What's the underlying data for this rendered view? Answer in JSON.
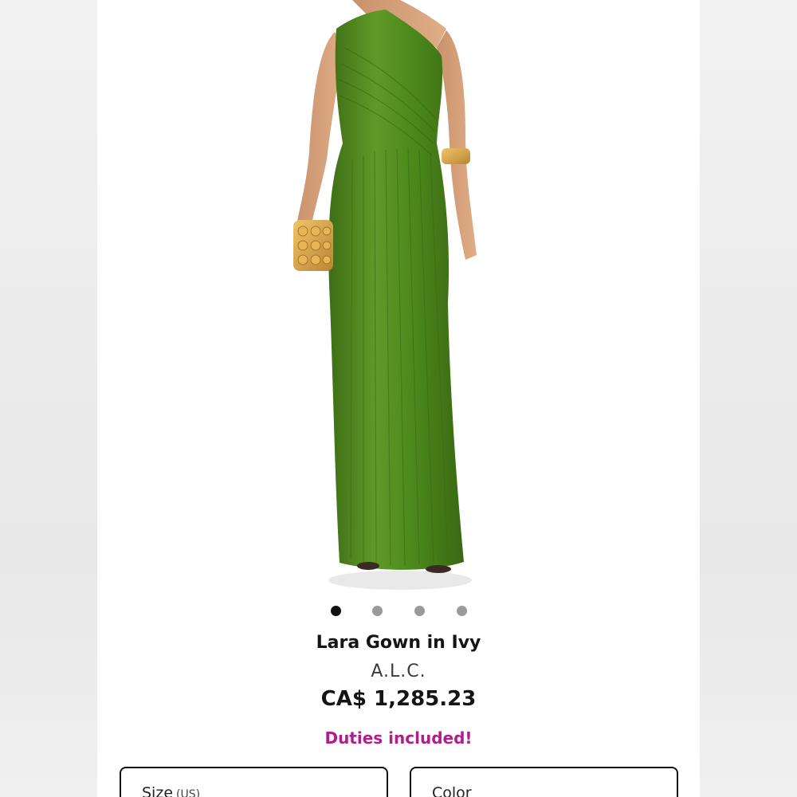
{
  "gallery": {
    "image_alt": "Model wearing green one-shoulder pleated satin gown holding gold clutch",
    "dots": [
      {
        "active": true
      },
      {
        "active": false
      },
      {
        "active": false
      },
      {
        "active": false
      }
    ]
  },
  "product": {
    "title": "Lara Gown in Ivy",
    "brand": "A.L.C.",
    "price": "CA$ 1,285.23",
    "duties_note": "Duties included!"
  },
  "options": {
    "size_label": "Size",
    "size_unit": "(US)",
    "color_label": "Color"
  },
  "colors": {
    "duties_text": "#b01e8c",
    "dress_green": "#4f8a1f",
    "active_dot": "#111111",
    "inactive_dot": "#9a9a9a"
  }
}
